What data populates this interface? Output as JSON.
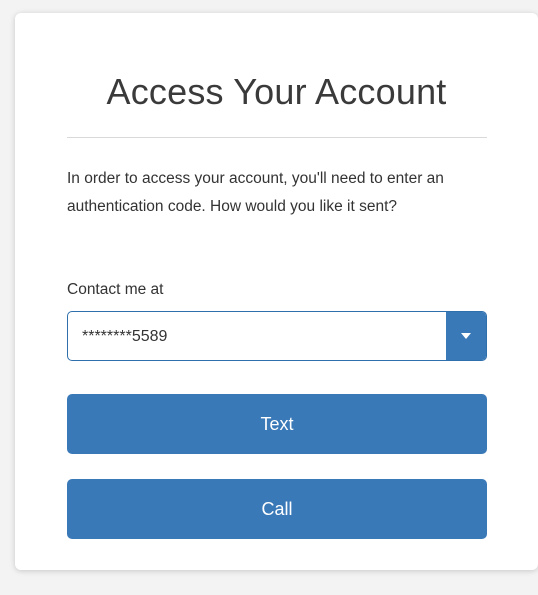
{
  "dialog": {
    "title": "Access Your Account",
    "description": "In order to access your account, you'll need to enter an authentication code. How would you like it sent?",
    "contact_label": "Contact me at",
    "contact_select": {
      "selected_value": "********5589"
    },
    "buttons": {
      "text_label": "Text",
      "call_label": "Call"
    },
    "icons": {
      "select_caret": "caret-down-icon"
    },
    "colors": {
      "primary": "#3a79b8",
      "border": "#2f6fad",
      "text": "#333333"
    }
  }
}
